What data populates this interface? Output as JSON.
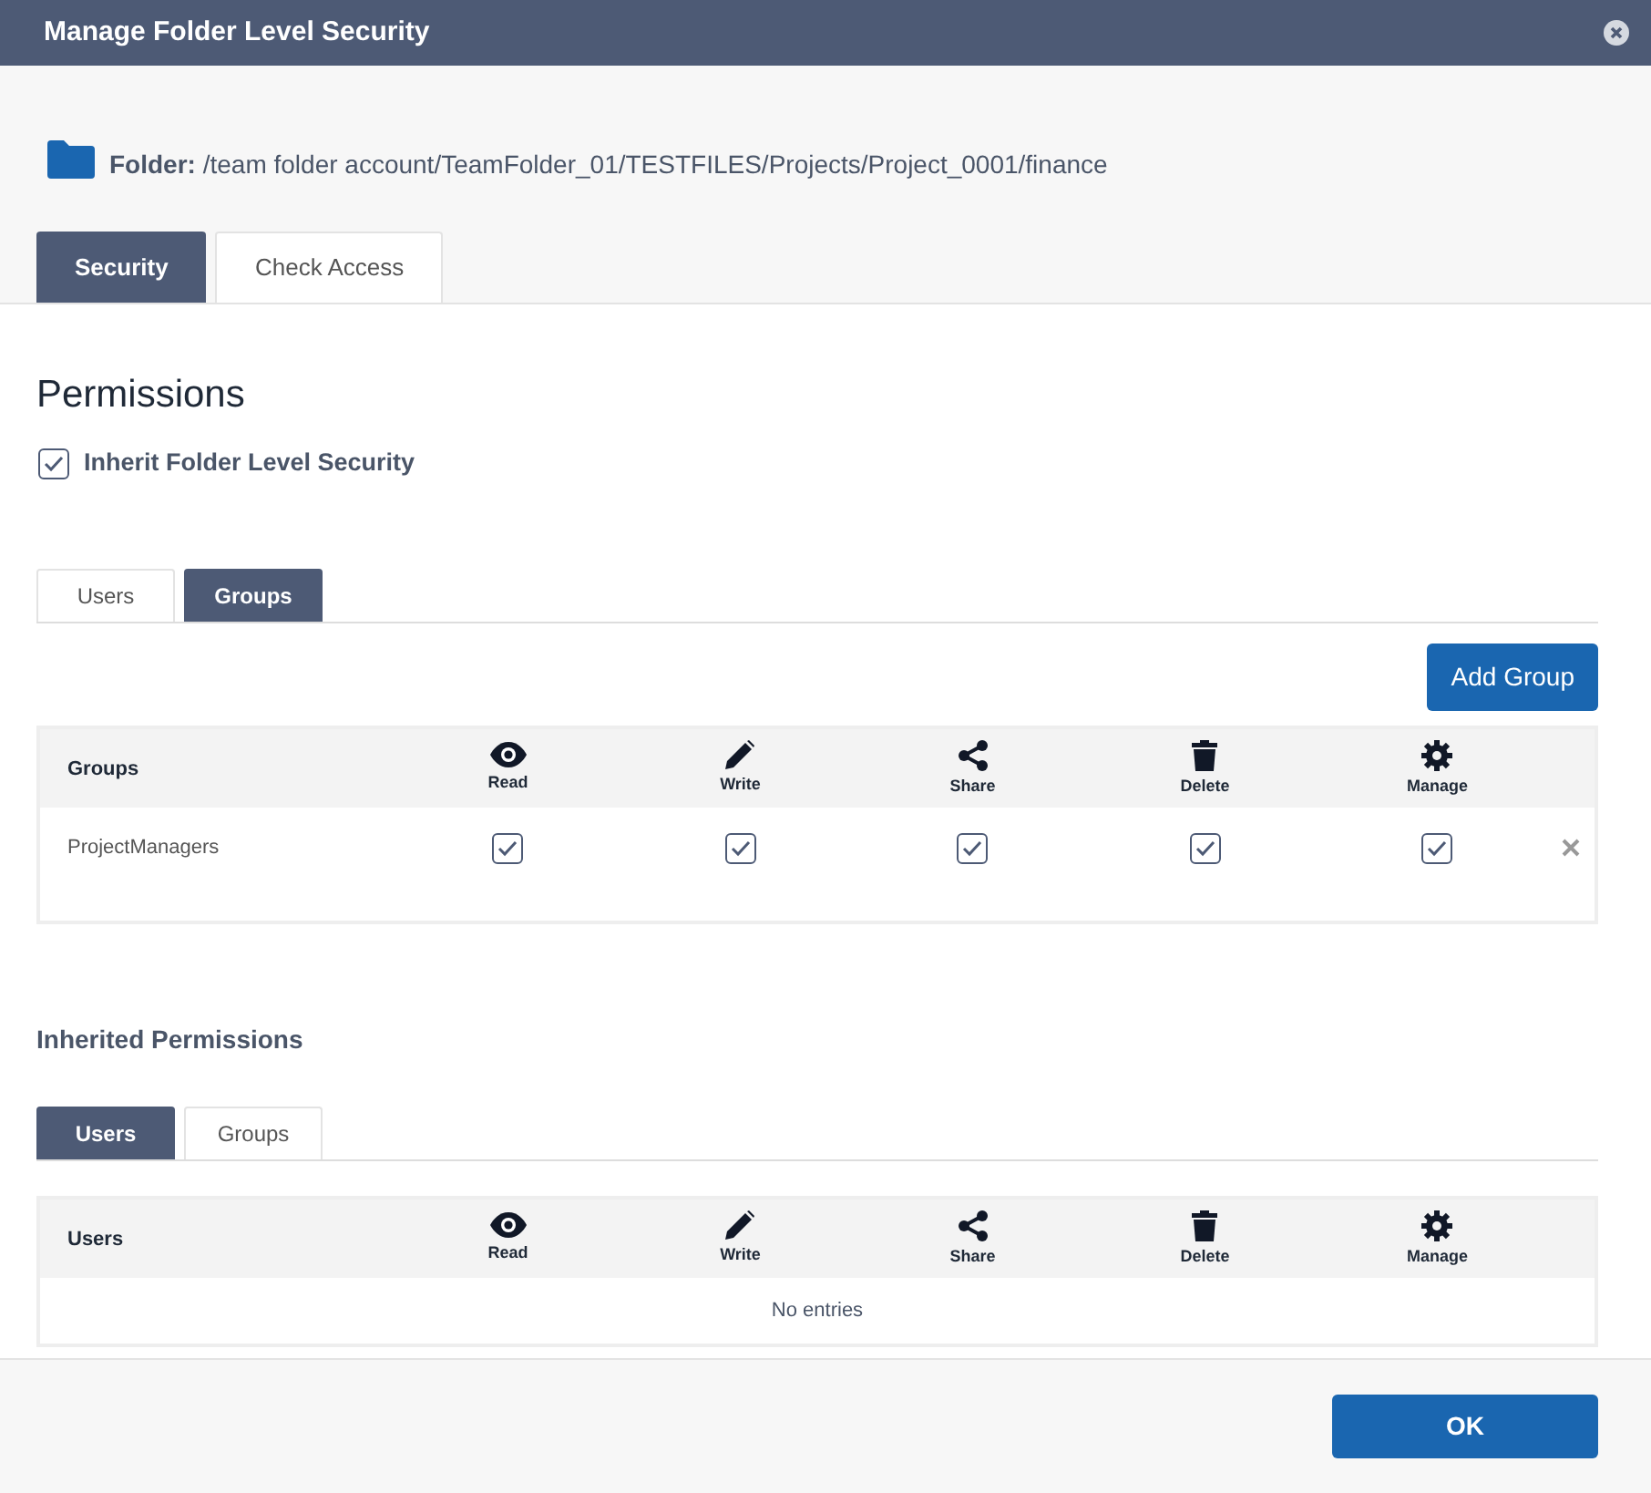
{
  "window": {
    "title": "Manage Folder Level Security"
  },
  "folder": {
    "label": "Folder:",
    "path": "/team folder account/TeamFolder_01/TESTFILES/Projects/Project_0001/finance"
  },
  "tabs": [
    {
      "label": "Security",
      "selected": true
    },
    {
      "label": "Check Access",
      "selected": false
    }
  ],
  "permissions": {
    "heading": "Permissions",
    "inherit": {
      "label": "Inherit Folder Level Security",
      "checked": true
    },
    "tabs": [
      {
        "label": "Users",
        "selected": false
      },
      {
        "label": "Groups",
        "selected": true
      }
    ],
    "add_button": "Add Group",
    "table": {
      "first_column": "Groups",
      "columns": [
        "Read",
        "Write",
        "Share",
        "Delete",
        "Manage"
      ],
      "rows": [
        {
          "name": "ProjectManagers",
          "checks": [
            true,
            true,
            true,
            true,
            true
          ]
        }
      ]
    }
  },
  "inherited": {
    "heading": "Inherited Permissions",
    "tabs": [
      {
        "label": "Users",
        "selected": true
      },
      {
        "label": "Groups",
        "selected": false
      }
    ],
    "table": {
      "first_column": "Users",
      "columns": [
        "Read",
        "Write",
        "Share",
        "Delete",
        "Manage"
      ],
      "empty_text": "No entries"
    }
  },
  "footer": {
    "ok_button": "OK"
  }
}
